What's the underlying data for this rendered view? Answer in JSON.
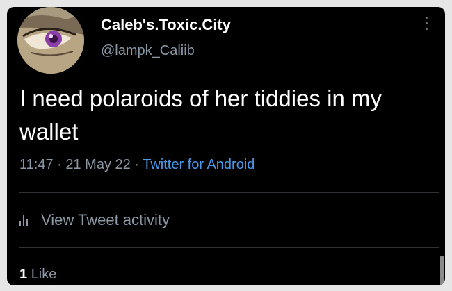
{
  "author": {
    "display_name": "Caleb's.Toxic.City",
    "handle": "@lampk_Caliib"
  },
  "tweet": {
    "text": "I need polaroids of her tiddies in my wallet",
    "time": "11:47",
    "date": "21 May 22",
    "separator": "·",
    "source": "Twitter for Android"
  },
  "activity": {
    "label": "View Tweet activity"
  },
  "likes": {
    "count": "1",
    "label": "Like"
  },
  "colors": {
    "background": "#000000",
    "secondary_text": "#8b98a5",
    "link": "#4a99e9",
    "divider": "#2f3336"
  },
  "icons": {
    "more": "more-vertical-icon",
    "activity": "bar-chart-icon"
  }
}
